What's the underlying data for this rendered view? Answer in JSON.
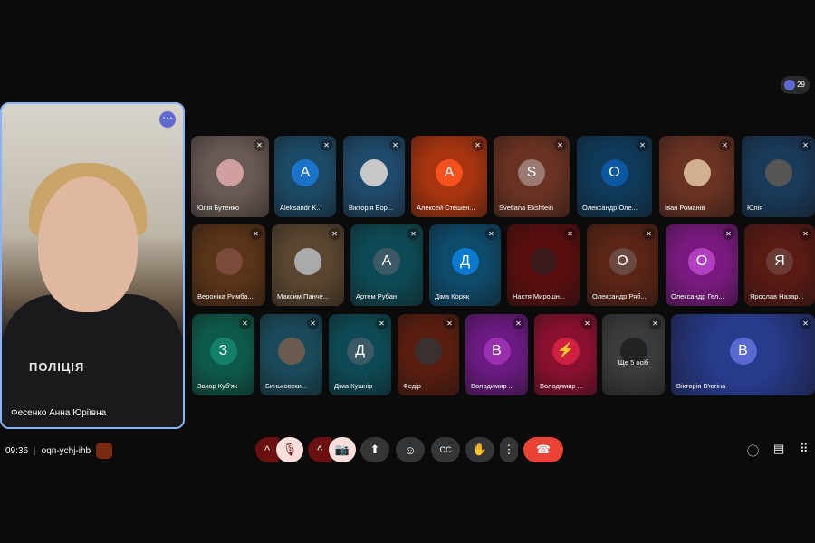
{
  "participant_count": "29",
  "self_view": {
    "name": "Фесенко Анна Юріївна",
    "badge": "ПОЛІЦІЯ"
  },
  "tiles": [
    {
      "name": "Юлія Бутенко",
      "bg": "#6a5a55",
      "avatar": "",
      "avcolor": "#d0a0a0"
    },
    {
      "name": "Aleksandr K...",
      "bg": "#1c4a66",
      "avatar": "A",
      "avcolor": "#1a73c8"
    },
    {
      "name": "Вікторія Бор...",
      "bg": "#1f4a6b",
      "avatar": "",
      "avcolor": "#c8c8c8"
    },
    {
      "name": "Алексей Стешен...",
      "bg": "#a83510",
      "avatar": "A",
      "avcolor": "#f4511e"
    },
    {
      "name": "Svetlana Ekshtein",
      "bg": "#6a3222",
      "avatar": "S",
      "avcolor": "#9a7a70"
    },
    {
      "name": "Олександр Оле...",
      "bg": "#0f3a5a",
      "avatar": "O",
      "avcolor": "#0b57a0"
    },
    {
      "name": "Іван Романів",
      "bg": "#6a3222",
      "avatar": "",
      "avcolor": "#d0b090"
    },
    {
      "name": "Юлія",
      "bg": "#1a3a5a",
      "avatar": "",
      "avcolor": "#555"
    },
    {
      "name": "Вероніка Римба...",
      "bg": "#5a3418",
      "avatar": "",
      "avcolor": "#7a4a3a"
    },
    {
      "name": "Максим Панче...",
      "bg": "#5a4630",
      "avatar": "",
      "avcolor": "#aaa"
    },
    {
      "name": "Артем Рубан",
      "bg": "#0e4a55",
      "avatar": "A",
      "avcolor": "#3c5a66"
    },
    {
      "name": "Діма Коряк",
      "bg": "#0e4a6a",
      "avatar": "Д",
      "avcolor": "#0b7ad0"
    },
    {
      "name": "Настя Мирошн...",
      "bg": "#5a0e0e",
      "avatar": "",
      "avcolor": "#3a1a1a"
    },
    {
      "name": "Олександр Ряб...",
      "bg": "#5a2416",
      "avatar": "O",
      "avcolor": "#6a4a40"
    },
    {
      "name": "Олександр Гел...",
      "bg": "#7a1a80",
      "avatar": "O",
      "avcolor": "#b040c0"
    },
    {
      "name": "Ярослав Назар...",
      "bg": "#5a1a14",
      "avatar": "Я",
      "avcolor": "#6a3a34"
    },
    {
      "name": "Захар Куб'як",
      "bg": "#0e5a4a",
      "avatar": "З",
      "avcolor": "#12806a"
    },
    {
      "name": "Биньковски...",
      "bg": "#1a4a5a",
      "avatar": "",
      "avcolor": "#6a5a50"
    },
    {
      "name": "Діма Кушнір",
      "bg": "#0e4a55",
      "avatar": "Д",
      "avcolor": "#3c5a66"
    },
    {
      "name": "Федір",
      "bg": "#5a1e10",
      "avatar": "",
      "avcolor": "#3a3030"
    },
    {
      "name": "Володимир ...",
      "bg": "#6a1a80",
      "avatar": "B",
      "avcolor": "#9a30b0"
    },
    {
      "name": "Володимир ...",
      "bg": "#8a1030",
      "avatar": "⚡",
      "avcolor": "#d02040"
    },
    {
      "name": "Ще 5 осіб",
      "bg": "#3a3b3d",
      "avatar": "",
      "avcolor": "#222"
    },
    {
      "name": "Вікторія В'югіна",
      "bg": "#283a8a",
      "avatar": "B",
      "avcolor": "#5a6ad0"
    }
  ],
  "meeting": {
    "time": "09:36",
    "code": "oqn-ychj-ihb"
  },
  "controls": {
    "mic_chevron": "^",
    "cam_chevron": "^",
    "mic": "🎙",
    "cam": "📷",
    "present": "⬆",
    "emoji": "☺",
    "captions": "CC",
    "hand": "✋",
    "more": "⋮",
    "leave": "☎"
  },
  "right_icons": {
    "info": "ⓘ",
    "chat": "▤",
    "activities": "⠿"
  }
}
